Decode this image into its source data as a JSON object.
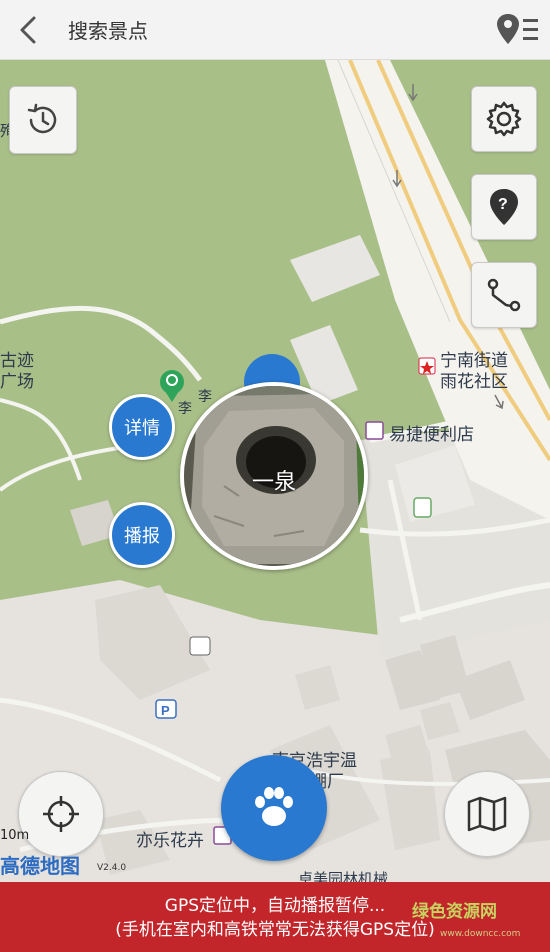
{
  "header": {
    "title": "搜索景点"
  },
  "map": {
    "labels": {
      "poi_left_1": "古迹",
      "poi_left_2": "广场",
      "street_1": "宁南街道",
      "street_2": "雨花社区",
      "store": "易捷便利店",
      "poi_top_small": "李",
      "poi_tag": "李",
      "company_1": "南京浩宇温",
      "company_2": "棚厂",
      "shop": "亦乐花卉",
      "bottom_road": "卓美园林机械",
      "left_edge": "殉"
    },
    "scale": "10m",
    "brand": "高德地图",
    "version": "V2.4.0"
  },
  "spot": {
    "name": "一泉",
    "detail_label": "详情",
    "broadcast_label": "播报"
  },
  "colors": {
    "accent": "#2a79d1",
    "status_bg": "#c2262b",
    "map_green": "#a7be86",
    "road_yellow": "#f2d79a"
  },
  "status": {
    "line1": "GPS定位中，自动播报暂停...",
    "line2": "(手机在室内和高铁常常无法获得GPS定位)"
  },
  "watermark": {
    "text": "绿色资源网",
    "sub": "www.downcc.com"
  },
  "icons": [
    "back-arrow-icon",
    "location-list-icon",
    "history-icon",
    "gear-icon",
    "help-pin-icon",
    "route-icon",
    "crosshair-icon",
    "paw-icon",
    "map-icon"
  ]
}
